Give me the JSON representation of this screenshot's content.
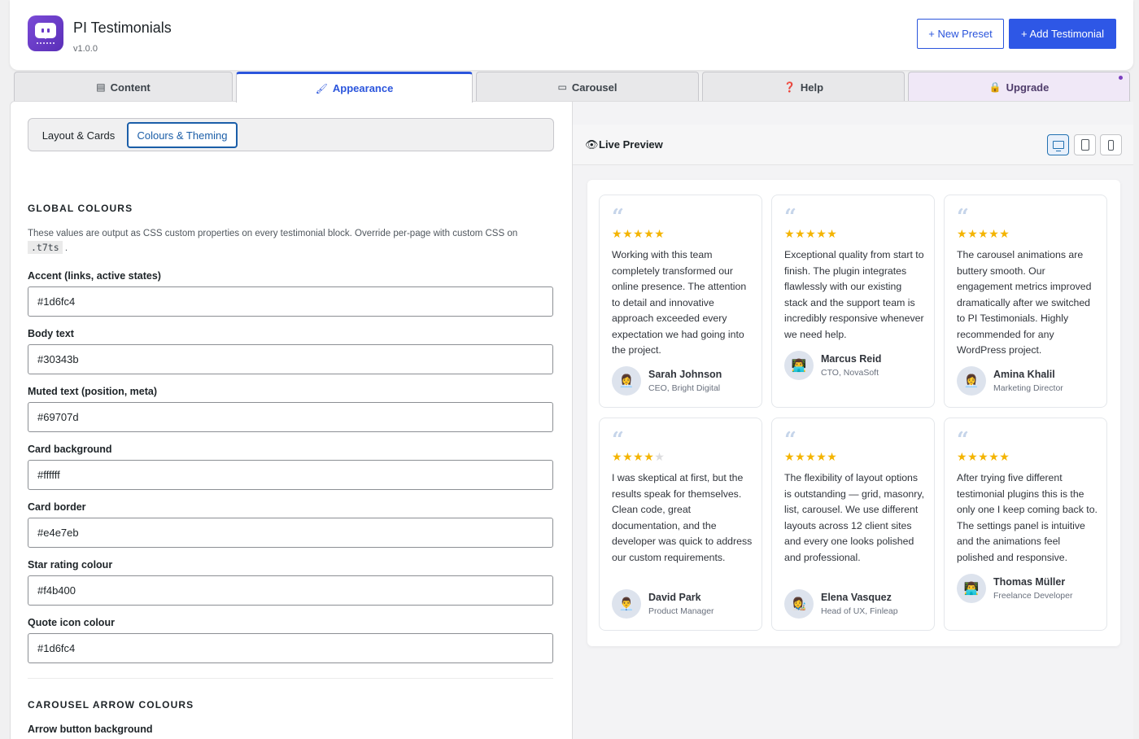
{
  "app": {
    "title": "PI Testimonials",
    "version": "v1.0.0"
  },
  "header": {
    "new_preset": "+ New Preset",
    "add_testimonial": "+ Add Testimonial"
  },
  "tabs": [
    {
      "label": "Content",
      "icon": "document-icon"
    },
    {
      "label": "Appearance",
      "icon": "brush-icon"
    },
    {
      "label": "Carousel",
      "icon": "carousel-icon"
    },
    {
      "label": "Help",
      "icon": "help-icon"
    },
    {
      "label": "Upgrade",
      "icon": "lock-icon"
    }
  ],
  "subtabs": [
    "Layout & Cards",
    "Colours & Theming"
  ],
  "global": {
    "title": "GLOBAL COLOURS",
    "desc": "These values are output as CSS custom properties on every testimonial block. Override per-page with custom CSS on",
    "code": ".t7ts",
    "fields": [
      {
        "label": "Accent (links, active states)",
        "value": "#1d6fc4"
      },
      {
        "label": "Body text",
        "value": "#30343b"
      },
      {
        "label": "Muted text (position, meta)",
        "value": "#69707d"
      },
      {
        "label": "Card background",
        "value": "#ffffff"
      },
      {
        "label": "Card border",
        "value": "#e4e7eb"
      },
      {
        "label": "Star rating colour",
        "value": "#f4b400"
      },
      {
        "label": "Quote icon colour",
        "value": "#1d6fc4"
      }
    ]
  },
  "carousel": {
    "title": "CAROUSEL ARROW COLOURS",
    "field_label": "Arrow button background"
  },
  "preview": {
    "title": "Live Preview",
    "devices": [
      "desktop-icon",
      "tablet-icon",
      "mobile-icon"
    ],
    "cards": [
      {
        "rating": 5,
        "text": "Working with this team completely transformed our online presence. The attention to detail and innovative approach exceeded every expectation we had going into the project.",
        "name": "Sarah Johnson",
        "role": "CEO, Bright Digital",
        "avatar": "👩‍💼"
      },
      {
        "rating": 5,
        "text": "Exceptional quality from start to finish. The plugin integrates flawlessly with our existing stack and the support team is incredibly responsive whenever we need help.",
        "name": "Marcus Reid",
        "role": "CTO, NovaSoft",
        "avatar": "👨‍💻"
      },
      {
        "rating": 5,
        "text": "The carousel animations are buttery smooth. Our engagement metrics improved dramatically after we switched to PI Testimonials. Highly recommended for any WordPress project.",
        "name": "Amina Khalil",
        "role": "Marketing Director",
        "avatar": "👩‍💼"
      },
      {
        "rating": 4,
        "text": "I was skeptical at first, but the results speak for themselves. Clean code, great documentation, and the developer was quick to address our custom requirements.",
        "name": "David Park",
        "role": "Product Manager",
        "avatar": "👨‍💼"
      },
      {
        "rating": 5,
        "text": "The flexibility of layout options is outstanding — grid, masonry, list, carousel. We use different layouts across 12 client sites and every one looks polished and professional.",
        "name": "Elena Vasquez",
        "role": "Head of UX, Finleap",
        "avatar": "👩‍🎨"
      },
      {
        "rating": 5,
        "text": "After trying five different testimonial plugins this is the only one I keep coming back to. The settings panel is intuitive and the animations feel polished and responsive.",
        "name": "Thomas Müller",
        "role": "Freelance Developer",
        "avatar": "👨‍💻"
      }
    ]
  },
  "colors": {
    "accent": "#2b55dc",
    "star": "#f4b400",
    "upgrade_bg": "#f0e8f7"
  }
}
